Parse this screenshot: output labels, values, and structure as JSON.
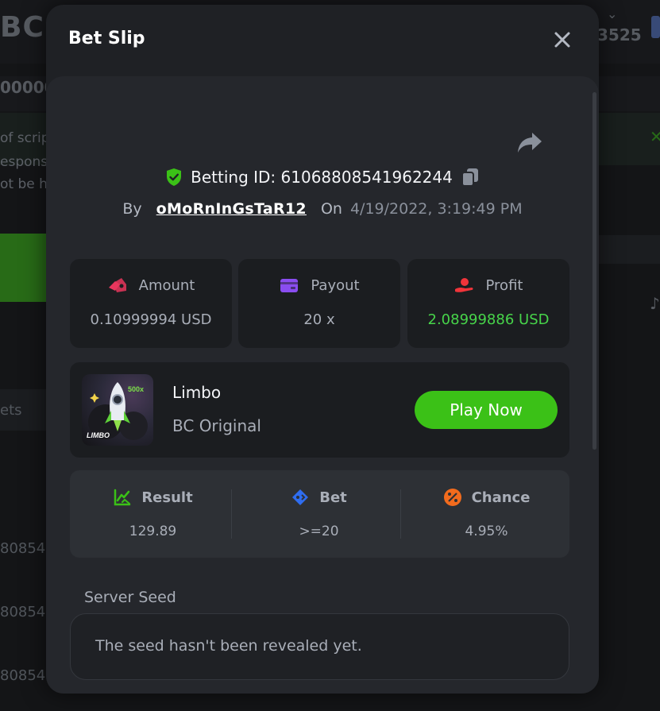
{
  "background": {
    "logo": "BC.",
    "balance_fragment": "3525",
    "amount_fragment": "00000",
    "notice_lines": [
      "of scrip",
      "espons",
      "ot be h"
    ],
    "tab_fragment": "ets",
    "row_fragments": [
      "80854",
      "80854",
      "80854"
    ]
  },
  "modal": {
    "title": "Bet Slip",
    "betting_id_label": "Betting ID: 61068808541962244",
    "by_label": "By",
    "username": "oMoRnInGsTaR12",
    "on_label": "On",
    "datetime": "4/19/2022, 3:19:49 PM"
  },
  "stats": [
    {
      "label": "Amount",
      "value": "0.10999994 USD",
      "icon": "amount-icon",
      "color": "#e8365d"
    },
    {
      "label": "Payout",
      "value": "20 x",
      "icon": "payout-icon",
      "color": "#8a4df0"
    },
    {
      "label": "Profit",
      "value": "2.08999886 USD",
      "icon": "profit-icon",
      "color": "#f0343a",
      "value_color": "#47d44a"
    }
  ],
  "game": {
    "name": "Limbo",
    "subtitle": "BC Original",
    "play_label": "Play Now",
    "thumb_badge": "500x",
    "thumb_caption": "LIMBO"
  },
  "result": [
    {
      "label": "Result",
      "value": "129.89",
      "icon": "result-icon"
    },
    {
      "label": "Bet",
      "value": ">=20",
      "icon": "bet-icon"
    },
    {
      "label": "Chance",
      "value": "4.95%",
      "icon": "chance-icon"
    }
  ],
  "seed": {
    "label": "Server Seed",
    "text": "The seed hasn't been revealed yet."
  },
  "colors": {
    "accent_green": "#3bc117",
    "profit_green": "#47d44a"
  }
}
